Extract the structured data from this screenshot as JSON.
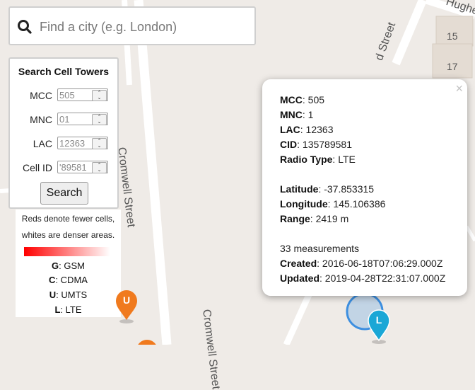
{
  "map": {
    "streets": [
      "Hughes",
      "Cromwell Street",
      "Cromwell Street",
      "d Street"
    ],
    "buildings": [
      "15",
      "17"
    ]
  },
  "search": {
    "placeholder": "Find a city (e.g. London)",
    "icon": "search-icon"
  },
  "tower_search": {
    "title": "Search Cell Towers",
    "fields": [
      {
        "label": "MCC",
        "value": "505"
      },
      {
        "label": "MNC",
        "value": "01"
      },
      {
        "label": "LAC",
        "value": "12363"
      },
      {
        "label": "Cell ID",
        "value": "'89581"
      }
    ],
    "button": "Search"
  },
  "legend": {
    "note_line1": "Reds denote fewer cells,",
    "note_line2": "whites are denser areas.",
    "types": [
      {
        "code": "G",
        "name": ": GSM"
      },
      {
        "code": "C",
        "name": ": CDMA"
      },
      {
        "code": "U",
        "name": ": UMTS"
      },
      {
        "code": "L",
        "name": ": LTE"
      }
    ]
  },
  "popup": {
    "close": "×",
    "lines": [
      {
        "label": "MCC",
        "value": ": 505"
      },
      {
        "label": "MNC",
        "value": ": 1"
      },
      {
        "label": "LAC",
        "value": ": 12363"
      },
      {
        "label": "CID",
        "value": ": 135789581"
      },
      {
        "label": "Radio Type",
        "value": ": LTE"
      },
      {
        "label": "Latitude",
        "value": ": -37.853315"
      },
      {
        "label": "Longitude",
        "value": ": 145.106386"
      },
      {
        "label": "Range",
        "value": ": 2419 m"
      }
    ],
    "measurements": "33 measurements",
    "created_label": "Created",
    "created_value": ": 2016-06-18T07:06:29.000Z",
    "updated_label": "Updated",
    "updated_value": ": 2019-04-28T22:31:07.000Z"
  },
  "markers": [
    {
      "letter": "U",
      "color": "#f07a1e"
    },
    {
      "letter": "L",
      "color": "#1aa7d6"
    }
  ],
  "colors": {
    "lte_marker": "#1aa7d6",
    "umts_marker": "#f07a1e",
    "range_circle": "#3d8fe0"
  }
}
